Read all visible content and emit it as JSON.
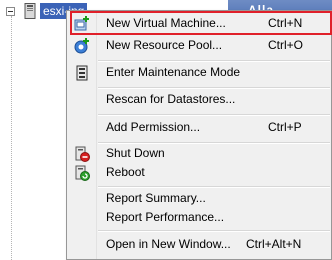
{
  "tree": {
    "host_label": "esxi-ing",
    "side_header": "Alla"
  },
  "menu": {
    "items": [
      {
        "label": "New Virtual Machine...",
        "shortcut": "Ctrl+N",
        "icon": "new-vm-icon"
      },
      {
        "label": "New Resource Pool...",
        "shortcut": "Ctrl+O",
        "icon": "resource-pool-icon"
      },
      {
        "label": "Enter Maintenance Mode",
        "shortcut": "",
        "icon": "maintenance-icon"
      },
      {
        "label": "Rescan for Datastores...",
        "shortcut": "",
        "icon": ""
      },
      {
        "label": "Add Permission...",
        "shortcut": "Ctrl+P",
        "icon": ""
      },
      {
        "label": "Shut Down",
        "shortcut": "",
        "icon": "shutdown-icon"
      },
      {
        "label": "Reboot",
        "shortcut": "",
        "icon": "reboot-icon"
      },
      {
        "label": "Report Summary...",
        "shortcut": "",
        "icon": ""
      },
      {
        "label": "Report Performance...",
        "shortcut": "",
        "icon": ""
      },
      {
        "label": "Open in New Window...",
        "shortcut": "Ctrl+Alt+N",
        "icon": ""
      }
    ]
  },
  "colors": {
    "selection": "#3b63b7",
    "highlight_box": "#e0202a",
    "menu_bg": "#f0f0f0"
  }
}
